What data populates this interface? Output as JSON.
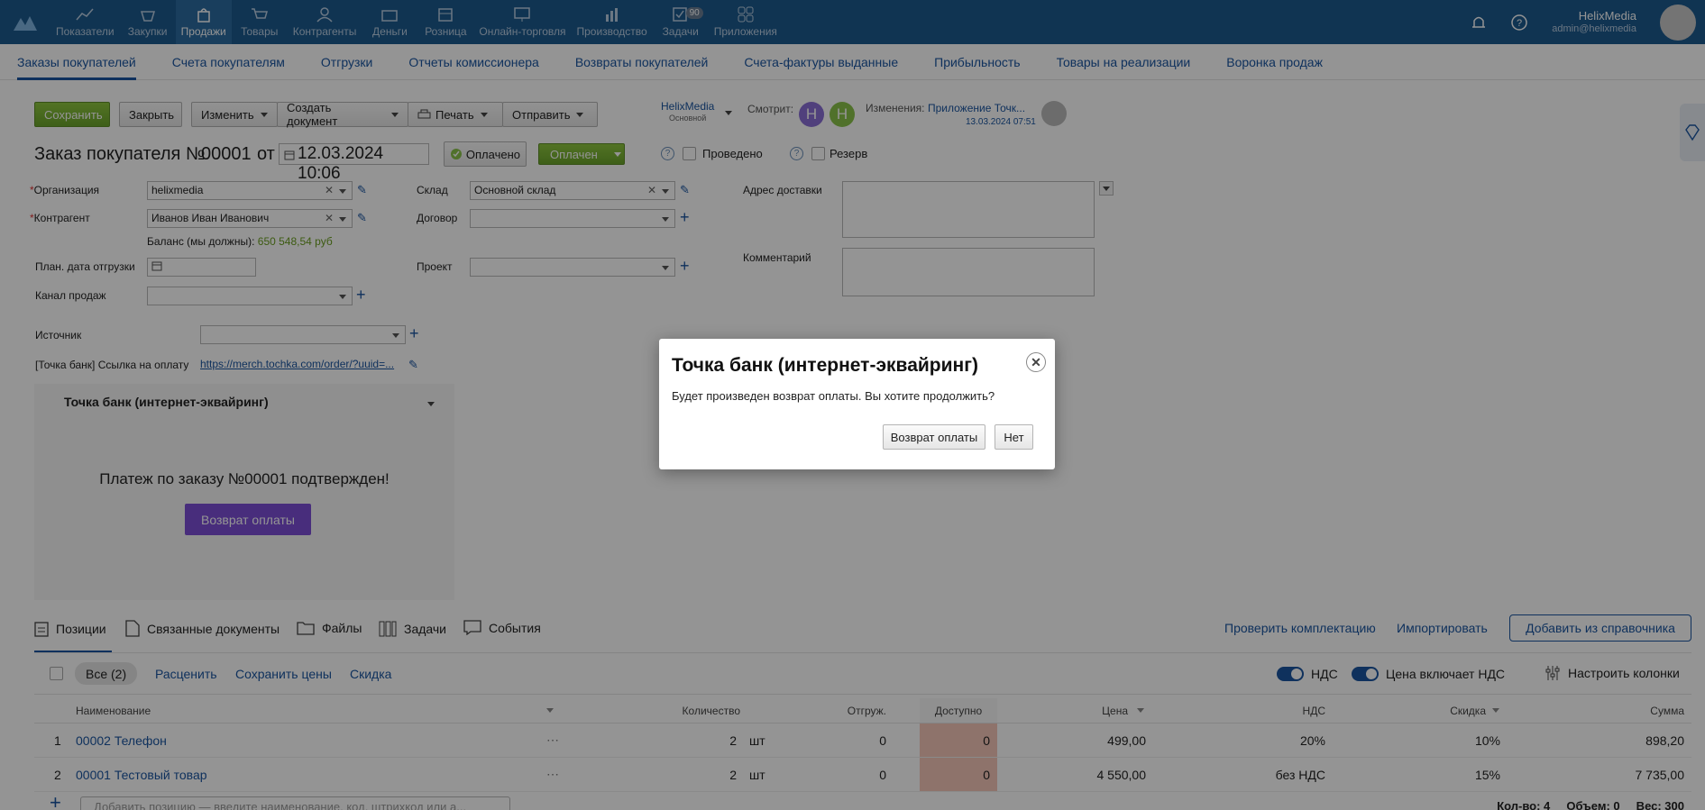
{
  "nav": {
    "items": [
      {
        "label": "Показатели",
        "icon": "chart-icon"
      },
      {
        "label": "Закупки",
        "icon": "basket-icon"
      },
      {
        "label": "Продажи",
        "icon": "bag-icon"
      },
      {
        "label": "Товары",
        "icon": "cart-icon"
      },
      {
        "label": "Контрагенты",
        "icon": "people-icon"
      },
      {
        "label": "Деньги",
        "icon": "wallet-icon"
      },
      {
        "label": "Розница",
        "icon": "register-icon"
      },
      {
        "label": "Онлайн-торговля",
        "icon": "monitor-icon"
      },
      {
        "label": "Производство",
        "icon": "factory-icon"
      },
      {
        "label": "Задачи",
        "icon": "tasks-icon",
        "badge": "90"
      },
      {
        "label": "Приложения",
        "icon": "apps-icon"
      }
    ],
    "active_index": 2,
    "user_name": "HelixMedia",
    "user_email": "admin@helixmedia"
  },
  "subnav": [
    "Заказы покупателей",
    "Счета покупателям",
    "Отгрузки",
    "Отчеты комиссионера",
    "Возвраты покупателей",
    "Счета-фактуры выданные",
    "Прибыльность",
    "Товары на реализации",
    "Воронка продаж"
  ],
  "toolbar": {
    "save": "Сохранить",
    "close": "Закрыть",
    "change": "Изменить",
    "create_doc": "Создать документ",
    "print": "Печать",
    "send": "Отправить",
    "org_name": "HelixMedia",
    "org_sub": "Основной",
    "watching": "Смотрит:",
    "avatar1": "H",
    "avatar2": "H",
    "changes_label": "Изменения:",
    "changes_value": "Приложение Точк...",
    "changes_date": "13.03.2024 07:51"
  },
  "order": {
    "title": "Заказ покупателя №",
    "number": "00001",
    "from": "от",
    "date": "12.03.2024 10:06",
    "paid_label": "Оплачено",
    "status": "Оплачен",
    "conducted": "Проведено",
    "reserve": "Резерв"
  },
  "form": {
    "org_label": "Организация",
    "org_value": "helixmedia",
    "contractor_label": "Контрагент",
    "contractor_value": "Иванов Иван Иванович",
    "balance_label": "Баланс (мы должны):",
    "balance_value": "650 548,54 руб",
    "ship_date_label": "План. дата отгрузки",
    "channel_label": "Канал продаж",
    "warehouse_label": "Склад",
    "warehouse_value": "Основной склад",
    "contract_label": "Договор",
    "project_label": "Проект",
    "address_label": "Адрес доставки",
    "comment_label": "Комментарий",
    "source_label": "Источник",
    "pay_link_label": "[Точка банк] Ссылка на оплату",
    "pay_link_value": "https://merch.tochka.com/order/?uuid=..."
  },
  "widget": {
    "title": "Точка банк (интернет-эквайринг)",
    "message": "Платеж по заказу №00001 подтвержден!",
    "refund_button": "Возврат оплаты"
  },
  "tabs": [
    "Позиции",
    "Связанные документы",
    "Файлы",
    "Задачи",
    "События"
  ],
  "tab_actions": {
    "check": "Проверить комплектацию",
    "import": "Импортировать",
    "add": "Добавить из справочника"
  },
  "filter": {
    "all": "Все (2)",
    "reprice": "Расценить",
    "save_prices": "Сохранить цены",
    "discount": "Скидка",
    "vat": "НДС",
    "price_incl_vat": "Цена включает НДС",
    "columns": "Настроить колонки"
  },
  "table": {
    "headers": {
      "name": "Наименование",
      "qty": "Количество",
      "shipped": "Отгруж.",
      "available": "Доступно",
      "price": "Цена",
      "vat": "НДС",
      "discount": "Скидка",
      "sum": "Сумма"
    },
    "rows": [
      {
        "n": "1",
        "name": "00002 Телефон",
        "qty": "2",
        "unit": "шт",
        "shipped": "0",
        "available": "0",
        "price": "499,00",
        "vat": "20%",
        "discount": "10%",
        "sum": "898,20"
      },
      {
        "n": "2",
        "name": "00001 Тестовый товар",
        "qty": "2",
        "unit": "шт",
        "shipped": "0",
        "available": "0",
        "price": "4 550,00",
        "vat": "без НДС",
        "discount": "15%",
        "sum": "7 735,00"
      }
    ],
    "add_placeholder": "Добавить позицию — введите наименование, код, штрихкод или а...",
    "footer": "Кол-во: 4     Объем: 0     Вес: 300"
  },
  "modal": {
    "title": "Точка банк (интернет-эквайринг)",
    "text": "Будет произведен возврат оплаты. Вы хотите продолжить?",
    "confirm": "Возврат оплаты",
    "cancel": "Нет"
  }
}
